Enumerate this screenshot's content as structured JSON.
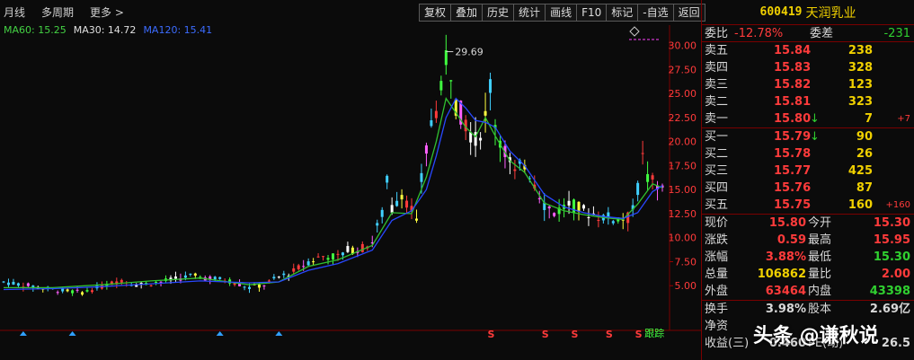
{
  "toolbar_left": {
    "period": "月线",
    "multi": "多周期",
    "more": "更多 >"
  },
  "toolbar": [
    "复权",
    "叠加",
    "历史",
    "统计",
    "画线",
    "F10",
    "标记",
    "-自选",
    "返回"
  ],
  "ma": {
    "ma60": "MA60: 15.25",
    "ma30": "MA30: 14.72",
    "ma120": "MA120: 15.41"
  },
  "chart_data": {
    "type": "candlestick",
    "y_ticks": [
      "30.00",
      "27.50",
      "25.00",
      "22.50",
      "20.00",
      "17.50",
      "15.00",
      "12.50",
      "10.00",
      "7.50",
      "5.00"
    ],
    "ylim": [
      2.5,
      31
    ],
    "peak_label": "29.69",
    "price_path": [
      [
        0,
        5.4
      ],
      [
        5,
        5.0
      ],
      [
        10,
        4.6
      ],
      [
        16,
        4.3
      ],
      [
        20,
        4.9
      ],
      [
        24,
        5.6
      ],
      [
        27,
        5.1
      ],
      [
        32,
        5.4
      ],
      [
        38,
        6.0
      ],
      [
        42,
        5.8
      ],
      [
        46,
        5.5
      ],
      [
        50,
        4.8
      ],
      [
        53,
        5.1
      ],
      [
        56,
        5.9
      ],
      [
        59,
        6.5
      ],
      [
        62,
        7.5
      ],
      [
        65,
        8.1
      ],
      [
        68,
        8.0
      ],
      [
        70,
        8.7
      ],
      [
        73,
        8.9
      ],
      [
        75,
        9.6
      ],
      [
        77,
        12.5
      ],
      [
        78,
        15.8
      ],
      [
        79,
        13.0
      ],
      [
        81,
        14.8
      ],
      [
        83,
        12.9
      ],
      [
        84,
        11.4
      ],
      [
        85,
        16.0
      ],
      [
        87,
        22.0
      ],
      [
        89,
        25.0
      ],
      [
        90,
        28.8
      ],
      [
        91,
        27.5
      ],
      [
        92,
        24.0
      ],
      [
        94,
        22.0
      ],
      [
        96,
        20.0
      ],
      [
        98,
        22.5
      ],
      [
        99,
        26.0
      ],
      [
        100,
        22.0
      ],
      [
        102,
        19.0
      ],
      [
        104,
        16.5
      ],
      [
        106,
        17.8
      ],
      [
        108,
        15.8
      ],
      [
        110,
        13.5
      ],
      [
        112,
        12.6
      ],
      [
        115,
        13.5
      ],
      [
        118,
        12.8
      ],
      [
        121,
        12.3
      ],
      [
        124,
        12.0
      ],
      [
        127,
        12.0
      ],
      [
        129,
        15.0
      ],
      [
        130,
        18.2
      ],
      [
        131,
        16.2
      ],
      [
        133,
        15.3
      ],
      [
        134,
        15.8
      ]
    ],
    "ma_blue": [
      [
        0,
        4.6
      ],
      [
        10,
        4.7
      ],
      [
        20,
        4.9
      ],
      [
        30,
        5.2
      ],
      [
        40,
        5.5
      ],
      [
        50,
        5.3
      ],
      [
        56,
        5.4
      ],
      [
        62,
        6.6
      ],
      [
        68,
        7.3
      ],
      [
        75,
        8.7
      ],
      [
        79,
        11.8
      ],
      [
        83,
        12.8
      ],
      [
        86,
        15.0
      ],
      [
        88,
        18.5
      ],
      [
        90,
        22.5
      ],
      [
        92,
        24.5
      ],
      [
        94,
        23.5
      ],
      [
        96,
        22.2
      ],
      [
        98,
        22.0
      ],
      [
        100,
        21.5
      ],
      [
        103,
        19.0
      ],
      [
        106,
        17.5
      ],
      [
        110,
        14.5
      ],
      [
        114,
        13.2
      ],
      [
        118,
        12.6
      ],
      [
        122,
        12.2
      ],
      [
        126,
        12.0
      ],
      [
        129,
        12.6
      ],
      [
        132,
        14.8
      ],
      [
        134,
        15.4
      ]
    ],
    "ma_green": [
      [
        0,
        4.8
      ],
      [
        10,
        4.8
      ],
      [
        20,
        5.1
      ],
      [
        30,
        5.5
      ],
      [
        40,
        5.8
      ],
      [
        50,
        5.1
      ],
      [
        56,
        5.4
      ],
      [
        62,
        7.0
      ],
      [
        68,
        7.7
      ],
      [
        75,
        9.2
      ],
      [
        79,
        12.6
      ],
      [
        83,
        12.5
      ],
      [
        86,
        16.3
      ],
      [
        88,
        20.0
      ],
      [
        90,
        24.5
      ],
      [
        92,
        23.0
      ],
      [
        94,
        21.5
      ],
      [
        96,
        20.5
      ],
      [
        98,
        22.5
      ],
      [
        100,
        20.6
      ],
      [
        103,
        18.0
      ],
      [
        106,
        16.8
      ],
      [
        110,
        13.6
      ],
      [
        114,
        12.8
      ],
      [
        118,
        12.4
      ],
      [
        122,
        12.1
      ],
      [
        126,
        11.9
      ],
      [
        129,
        13.5
      ],
      [
        132,
        15.6
      ],
      [
        134,
        15.2
      ]
    ],
    "markers": [
      {
        "i": 4,
        "t": "tri"
      },
      {
        "i": 14,
        "t": "tri"
      },
      {
        "i": 44,
        "t": "tri"
      },
      {
        "i": 56,
        "t": "tri"
      },
      {
        "i": 99,
        "t": "S"
      },
      {
        "i": 110,
        "t": "S"
      },
      {
        "i": 116,
        "t": "S"
      },
      {
        "i": 123,
        "t": "S"
      },
      {
        "i": 129,
        "t": "S"
      }
    ],
    "marker_tag": "跟踪"
  },
  "stock": {
    "code": "600419",
    "name": "天润乳业"
  },
  "order": {
    "wb_label": "委比",
    "wb": "-12.78%",
    "wc_label": "委差",
    "wc": "-231"
  },
  "asks": [
    {
      "label": "卖五",
      "price": "15.84",
      "vol": "238",
      "chg": ""
    },
    {
      "label": "卖四",
      "price": "15.83",
      "vol": "328",
      "chg": ""
    },
    {
      "label": "卖三",
      "price": "15.82",
      "vol": "123",
      "chg": ""
    },
    {
      "label": "卖二",
      "price": "15.81",
      "vol": "323",
      "chg": ""
    },
    {
      "label": "卖一",
      "price": "15.80",
      "vol": "7",
      "chg": "+7",
      "arrow": "↓"
    }
  ],
  "bids": [
    {
      "label": "买一",
      "price": "15.79",
      "vol": "90",
      "chg": "",
      "arrow": "↓"
    },
    {
      "label": "买二",
      "price": "15.78",
      "vol": "26",
      "chg": ""
    },
    {
      "label": "买三",
      "price": "15.77",
      "vol": "425",
      "chg": ""
    },
    {
      "label": "买四",
      "price": "15.76",
      "vol": "87",
      "chg": ""
    },
    {
      "label": "买五",
      "price": "15.75",
      "vol": "160",
      "chg": "+160"
    }
  ],
  "quote": [
    {
      "l1": "现价",
      "v1": "15.80",
      "l2": "今开",
      "v2": "15.30"
    },
    {
      "l1": "涨跌",
      "v1": "0.59",
      "l2": "最高",
      "v2": "15.95"
    },
    {
      "l1": "涨幅",
      "v1": "3.88%",
      "l2": "最低",
      "v2": "15.30"
    },
    {
      "l1": "总量",
      "v1": "106862",
      "l2": "量比",
      "v2": "2.00"
    },
    {
      "l1": "外盘",
      "v1": "63464",
      "l2": "内盘",
      "v2": "43398"
    }
  ],
  "extra": [
    {
      "l1": "换手",
      "v1": "3.98%",
      "l2": "股本",
      "v2": "2.69亿"
    },
    {
      "l1": "净资",
      "v1": "",
      "l2": "",
      "v2": ""
    },
    {
      "l1": "收益(三)",
      "v1": "0.460",
      "l2": "PE(动)",
      "v2": "26.5"
    }
  ],
  "watermark": "头条 @谦秋说"
}
